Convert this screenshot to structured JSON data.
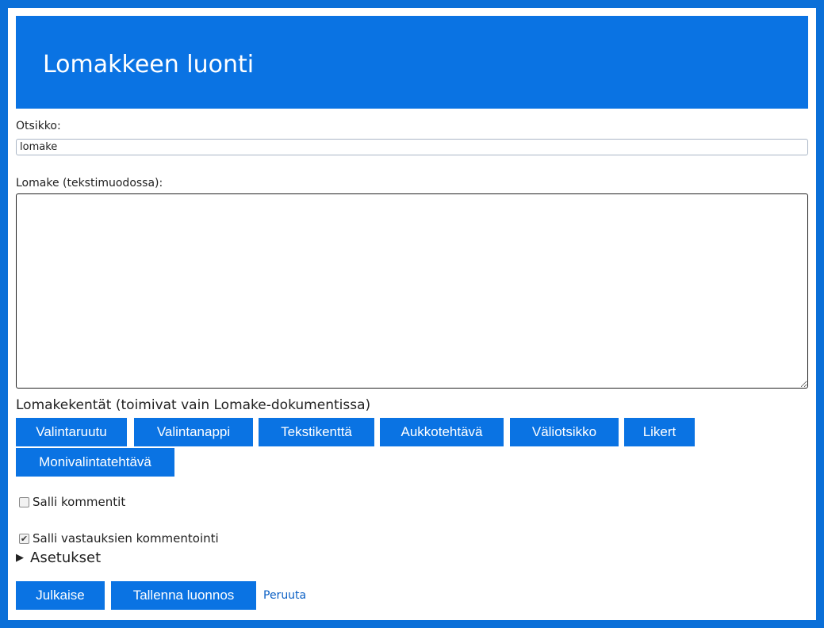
{
  "header": {
    "title": "Lomakkeen luonti"
  },
  "form": {
    "title_label": "Otsikko:",
    "title_value": "lomake",
    "content_label": "Lomake (tekstimuodossa):",
    "content_value": ""
  },
  "fields": {
    "section_label": "Lomakekentät (toimivat vain Lomake-dokumentissa)",
    "buttons": [
      "Valintaruutu",
      "Valintanappi",
      "Tekstikenttä",
      "Aukkotehtävä",
      "Väliotsikko",
      "Likert",
      "Monivalintatehtävä"
    ]
  },
  "options": {
    "allow_comments_label": "Salli kommentit",
    "allow_comments_checked": false,
    "allow_answer_comments_label": "Salli vastauksien kommentointi",
    "allow_answer_comments_checked": true,
    "settings_label": "Asetukset",
    "settings_icon": "triangle-right-icon"
  },
  "actions": {
    "publish_label": "Julkaise",
    "save_draft_label": "Tallenna luonnos",
    "cancel_label": "Peruuta"
  },
  "colors": {
    "accent": "#0a73e3",
    "border": "#0a6fd8",
    "link": "#0a5fc4"
  }
}
